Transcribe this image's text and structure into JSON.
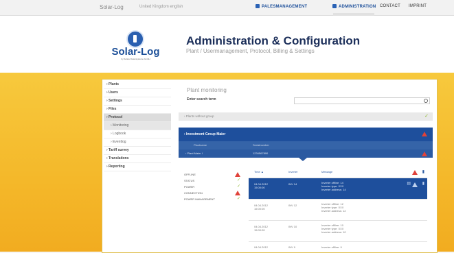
{
  "topbar": {
    "logo_small": "Solar-Log",
    "language": "United Kingdom english",
    "nav": [
      {
        "label": "PALESMANAGEMENT"
      },
      {
        "label": "ADMINISTRATION"
      },
      {
        "label": "CONTACT"
      },
      {
        "label": "IMPRINT"
      }
    ]
  },
  "header": {
    "logo_name": "Solar-Log",
    "logo_sub": "by Solare Datensysteme GmbH",
    "title": "Administration & Configuration",
    "subtitle": "Plant / Usermanagement, Protocol, Billing & Settings"
  },
  "sidebar": {
    "items": [
      {
        "label": "› Plants"
      },
      {
        "label": "› Users"
      },
      {
        "label": "› Settings"
      },
      {
        "label": "› Files"
      },
      {
        "label": "› Protocol"
      },
      {
        "label": "› Monitoring"
      },
      {
        "label": "› Logbook"
      },
      {
        "label": "› Eventlog"
      },
      {
        "label": "› Tariff survey"
      },
      {
        "label": "› Translations"
      },
      {
        "label": "› Reporting"
      }
    ]
  },
  "content": {
    "title": "Plant monitoring",
    "search_label": "Enter search term",
    "group_without": "› Plants without group",
    "group_blue": "› Investment Group Maier",
    "col_plantname": "Plantname",
    "col_serial": "Serialnumber",
    "plant_name": "› Plant Maier I",
    "plant_serial": "1234567890",
    "status": [
      {
        "label": "OFFLINE",
        "state": "warn"
      },
      {
        "label": "STATUS",
        "state": "ok"
      },
      {
        "label": "POWER",
        "state": "ok"
      },
      {
        "label": "CONNECTION",
        "state": "warn"
      },
      {
        "label": "POWER MANAGEMENT",
        "state": "ok"
      }
    ],
    "table_head": {
      "time": "Time ▲",
      "inverter": "Inverter",
      "message": "Message"
    },
    "rows": [
      {
        "time": "04.04.2012\n15:00:00",
        "inverter": "INV 14",
        "message": "Inverter offline: 14\nInverter type: XXX\nInverter address: 14",
        "selected": true
      },
      {
        "time": "04.04.2012\n15:00:00",
        "inverter": "INV 12",
        "message": "Inverter offline: 12\nInverter type: XXX\nInverter address: 12",
        "selected": false
      },
      {
        "time": "04.04.2012\n15:00:00",
        "inverter": "INV 10",
        "message": "Inverter offline: 10\nInverter type: XXX\nInverter address: 10",
        "selected": false
      },
      {
        "time": "04.04.2012",
        "inverter": "INV 9",
        "message": "Inverter offline: 9",
        "selected": false
      }
    ]
  },
  "colors": {
    "accent_blue": "#1e4f9c",
    "warning_red": "#e0423a",
    "ok_green": "#8bb82a",
    "background_yellow": "#f4b82a"
  },
  "icons": [
    "warning-icon",
    "check-icon",
    "search-icon",
    "trash-icon",
    "document-icon",
    "user-icon"
  ]
}
